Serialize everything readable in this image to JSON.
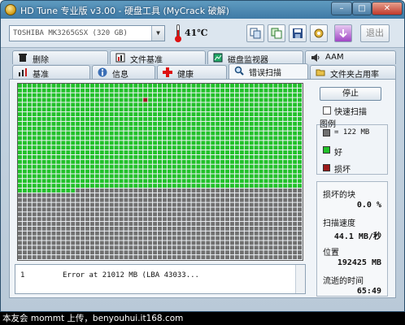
{
  "window": {
    "title": "HD Tune 专业版 v3.00 - 硬盘工具 (MyCrack 破解)"
  },
  "caption_buttons": {
    "minimize": "–",
    "maximize": "□",
    "close": "✕"
  },
  "toolbar": {
    "drive": "TOSHIBA MK3265GSX (320 GB)",
    "temperature": "41℃",
    "exit_label": "退出",
    "icons": [
      "copy-icon",
      "copy-all-icon",
      "save-icon",
      "options-icon",
      "download-icon"
    ]
  },
  "tabs_top": [
    {
      "label": "删除",
      "icon": "trash-icon"
    },
    {
      "label": "文件基准",
      "icon": "file-benchmark-icon"
    },
    {
      "label": "磁盘监视器",
      "icon": "disk-monitor-icon"
    },
    {
      "label": "AAM",
      "icon": "speaker-icon"
    }
  ],
  "tabs_bottom": [
    {
      "label": "基准",
      "icon": "benchmark-icon"
    },
    {
      "label": "信息",
      "icon": "info-icon"
    },
    {
      "label": "健康",
      "icon": "health-cross-icon"
    },
    {
      "label": "错误扫描",
      "icon": "magnifier-icon",
      "active": true
    },
    {
      "label": "文件夹占用率",
      "icon": "folder-icon"
    }
  ],
  "scan": {
    "grid_cols": 59,
    "grid_rows": 37,
    "scanned_fraction": 0.6,
    "bad_block_col": 26,
    "bad_block_row": 3,
    "colors": {
      "good": "#22c12a",
      "bad": "#9b1a1a",
      "unscanned": "#707070"
    }
  },
  "controls": {
    "stop": "停止",
    "quick_scan": "快速扫描",
    "quick_scan_checked": false
  },
  "legend": {
    "title": "图例",
    "block": "= 122 MB",
    "good": "好",
    "bad": "损坏"
  },
  "stats": {
    "bad_label": "损坏的块",
    "bad_value": "0.0 %",
    "speed_label": "扫描速度",
    "speed_value": "44.1 MB/秒",
    "position_label": "位置",
    "position_value": "192425 MB",
    "elapsed_label": "流逝的时间",
    "elapsed_value": "65:49"
  },
  "log": {
    "num": "1",
    "text": "Error at 21012 MB (LBA 43033..."
  },
  "caption": "本友会 mommt 上传，benyouhui.it168.com"
}
